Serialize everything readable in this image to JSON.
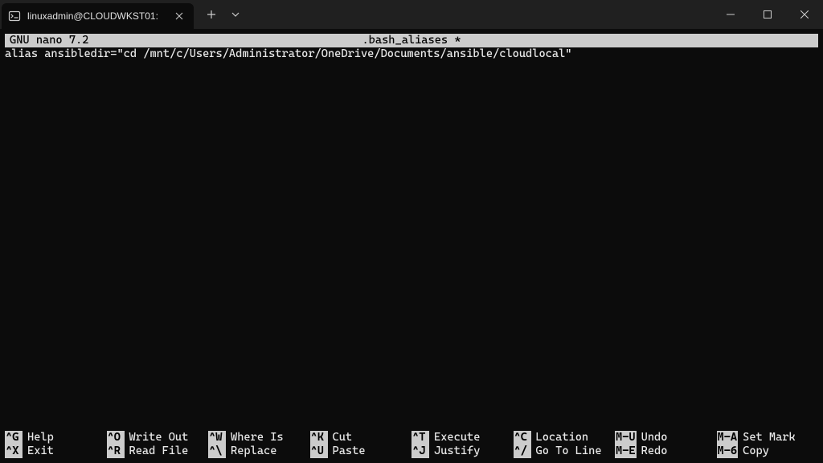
{
  "window": {
    "tab_title": "linuxadmin@CLOUDWKST01:"
  },
  "nano": {
    "version_label": "GNU nano 7.2",
    "filename": ".bash_aliases *",
    "content": "alias ansibledir=\"cd /mnt/c/Users/Administrator/OneDrive/Documents/ansible/cloudlocal\""
  },
  "shortcuts": {
    "row1": [
      {
        "key": "^G",
        "label": "Help"
      },
      {
        "key": "^O",
        "label": "Write Out"
      },
      {
        "key": "^W",
        "label": "Where Is"
      },
      {
        "key": "^K",
        "label": "Cut"
      },
      {
        "key": "^T",
        "label": "Execute"
      },
      {
        "key": "^C",
        "label": "Location"
      }
    ],
    "row2": [
      {
        "key": "^X",
        "label": "Exit"
      },
      {
        "key": "^R",
        "label": "Read File"
      },
      {
        "key": "^\\",
        "label": "Replace"
      },
      {
        "key": "^U",
        "label": "Paste"
      },
      {
        "key": "^J",
        "label": "Justify"
      },
      {
        "key": "^/",
        "label": "Go To Line"
      }
    ],
    "col7": [
      {
        "key": "M-U",
        "label": "Undo"
      },
      {
        "key": "M-E",
        "label": "Redo"
      }
    ],
    "col8": [
      {
        "key": "M-A",
        "label": "Set Mark"
      },
      {
        "key": "M-6",
        "label": "Copy"
      }
    ]
  }
}
